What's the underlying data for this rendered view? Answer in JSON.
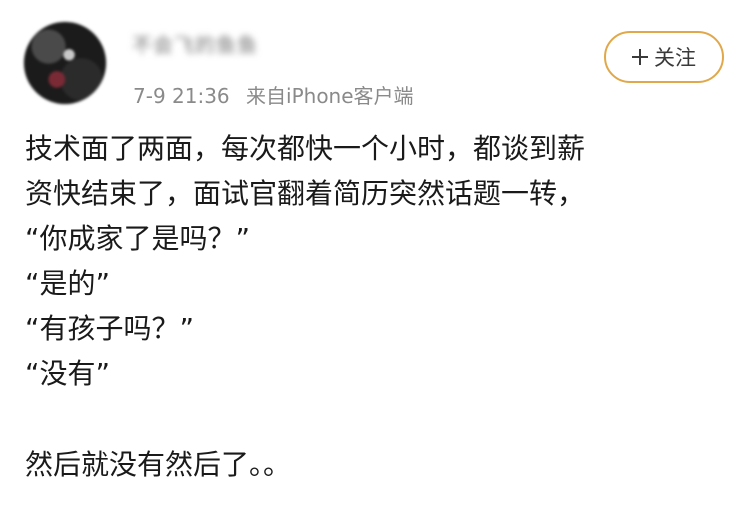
{
  "post": {
    "username": "不会飞的鱼鱼",
    "time": "7-9 21:36",
    "source": "来自iPhone客户端",
    "follow_label": "关注",
    "content_lines": [
      "技术面了两面，每次都快一个小时，都谈到薪",
      "资快结束了，面试官翻着简历突然话题一转，",
      "“你成家了是吗？”",
      "“是的”",
      "“有孩子吗？”",
      "“没有”"
    ],
    "closing_line": "然后就没有然后了。。"
  },
  "colors": {
    "follow_border": "#e0a84a",
    "meta_text": "#8a8a8a",
    "body_text": "#1a1a1a"
  }
}
